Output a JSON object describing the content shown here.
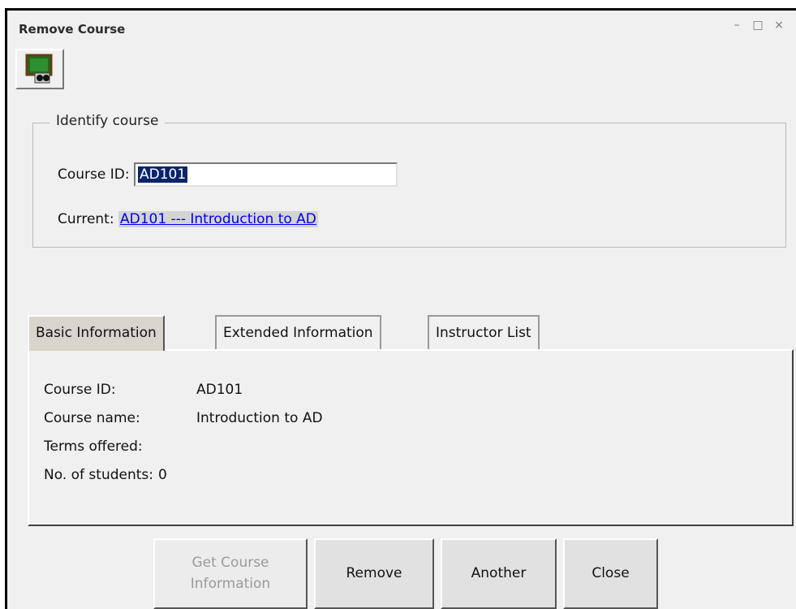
{
  "window": {
    "title": "Remove Course",
    "controls": [
      "–",
      "□",
      "×"
    ]
  },
  "toolbar": {
    "icon": "course-lookup-icon"
  },
  "identify": {
    "legend": "Identify course",
    "course_id_label": "Course ID:",
    "course_id_value": "AD101",
    "current_label": "Current:",
    "current_link": "AD101 --- Introduction to AD"
  },
  "tabs": [
    {
      "label": "Basic Information",
      "active": true
    },
    {
      "label": "Extended Information",
      "active": false
    },
    {
      "label": "Instructor List",
      "active": false
    }
  ],
  "basic": {
    "rows": [
      {
        "label": "Course ID:",
        "value": "AD101"
      },
      {
        "label": "Course name:",
        "value": "Introduction to AD"
      },
      {
        "label": "Terms offered:",
        "value": ""
      },
      {
        "label": "No. of students:",
        "value": "0"
      }
    ]
  },
  "buttons": {
    "get_info_line1": "Get Course",
    "get_info_line2": "Information",
    "remove": "Remove",
    "another": "Another",
    "close": "Close"
  }
}
